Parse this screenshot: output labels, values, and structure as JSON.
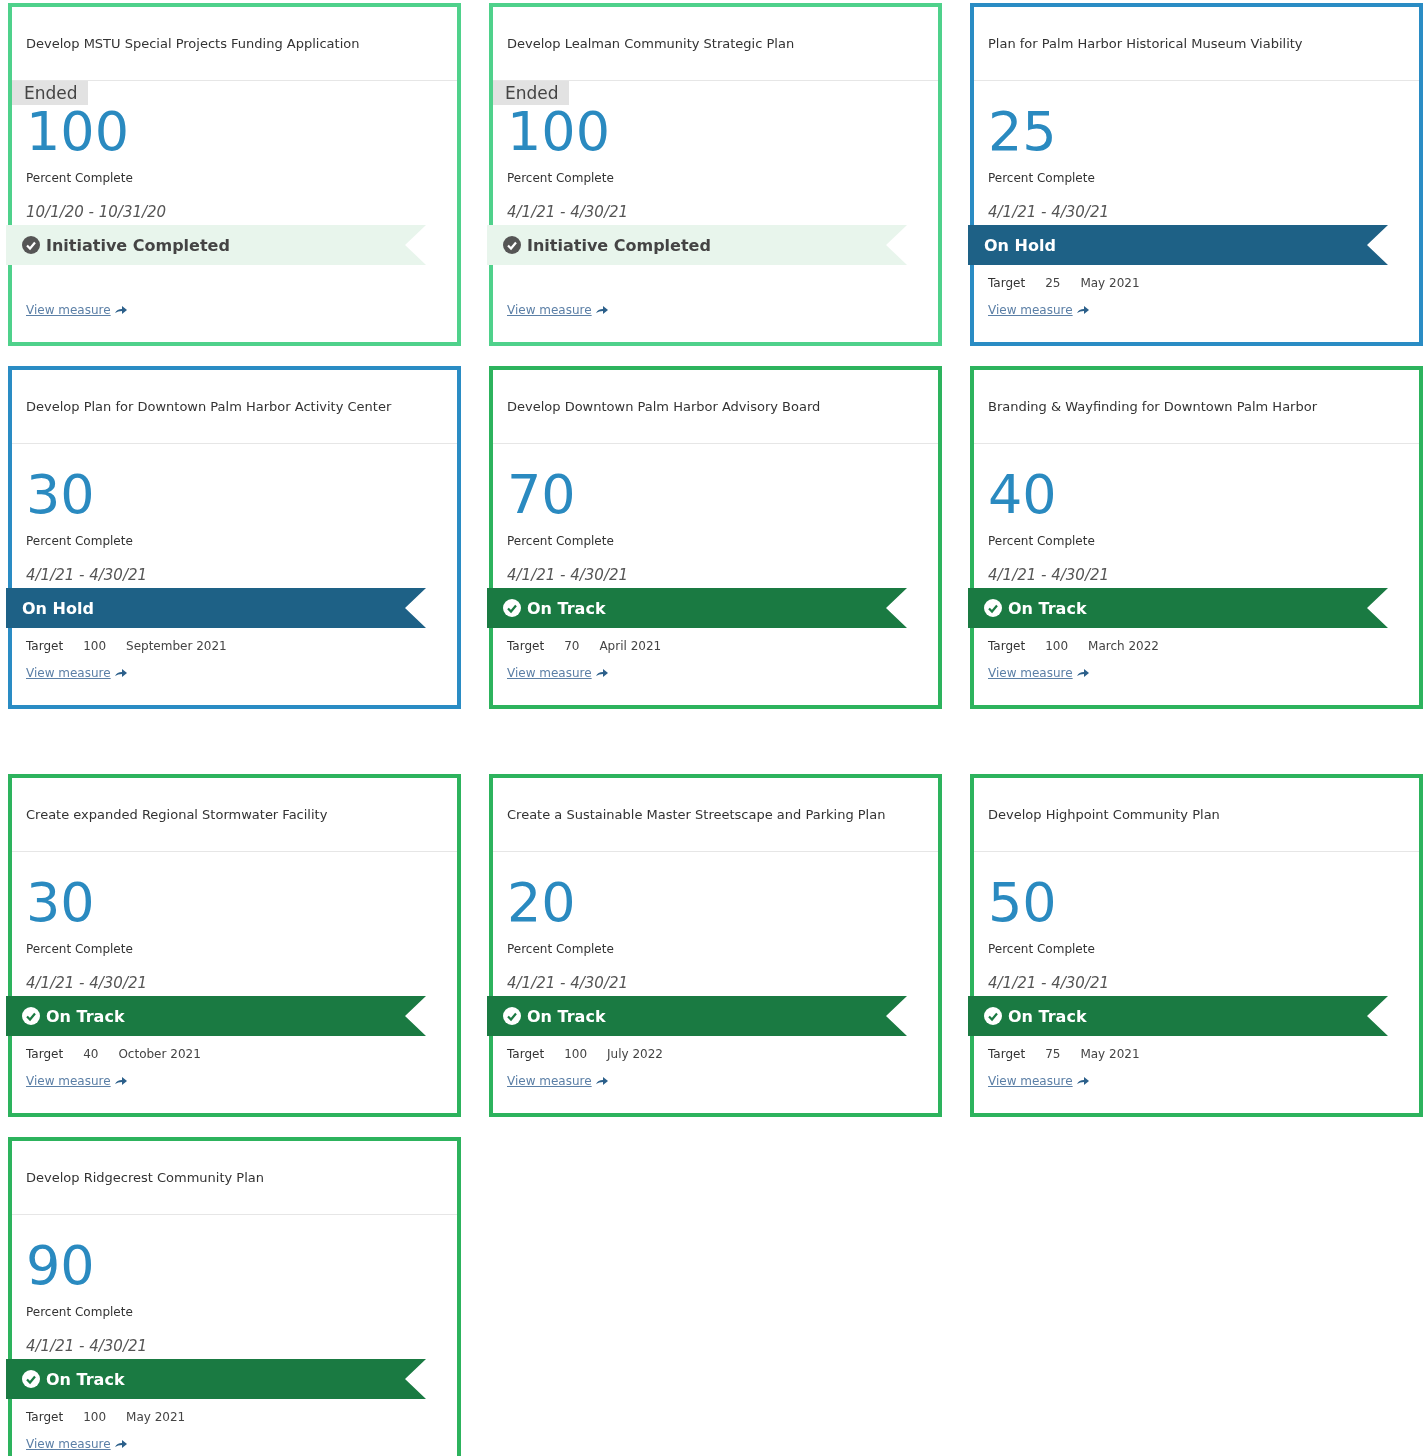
{
  "cards": [
    {
      "title": "Develop MSTU Special Projects Funding Application",
      "ended": true,
      "badge": "Ended",
      "value": "100",
      "value_label": "Percent Complete",
      "dates": "10/1/20 - 10/31/20",
      "status": {
        "kind": "completed",
        "label": "Initiative Completed"
      },
      "link": "View measure"
    },
    {
      "title": "Develop Lealman Community Strategic Plan",
      "ended": true,
      "badge": "Ended",
      "value": "100",
      "value_label": "Percent Complete",
      "dates": "4/1/21 - 4/30/21",
      "status": {
        "kind": "completed",
        "label": "Initiative Completed"
      },
      "link": "View measure"
    },
    {
      "title": "Plan for Palm Harbor Historical Museum Viability",
      "ended": false,
      "value": "25",
      "value_label": "Percent Complete",
      "dates": "4/1/21 - 4/30/21",
      "status": {
        "kind": "on_hold",
        "label": "On Hold"
      },
      "target": {
        "label": "Target",
        "value": "25",
        "date": "May 2021"
      },
      "link": "View measure"
    },
    {
      "title": "Develop Plan for Downtown Palm Harbor Activity Center",
      "ended": false,
      "value": "30",
      "value_label": "Percent Complete",
      "dates": "4/1/21 - 4/30/21",
      "status": {
        "kind": "on_hold",
        "label": "On Hold"
      },
      "target": {
        "label": "Target",
        "value": "100",
        "date": "September 2021"
      },
      "link": "View measure"
    },
    {
      "title": "Develop Downtown Palm Harbor Advisory Board",
      "ended": false,
      "value": "70",
      "value_label": "Percent Complete",
      "dates": "4/1/21 - 4/30/21",
      "status": {
        "kind": "on_track",
        "label": "On Track"
      },
      "target": {
        "label": "Target",
        "value": "70",
        "date": "April 2021"
      },
      "link": "View measure"
    },
    {
      "title": "Branding & Wayfinding for Downtown Palm Harbor",
      "ended": false,
      "value": "40",
      "value_label": "Percent Complete",
      "dates": "4/1/21 - 4/30/21",
      "status": {
        "kind": "on_track",
        "label": "On Track"
      },
      "target": {
        "label": "Target",
        "value": "100",
        "date": "March 2022"
      },
      "link": "View measure"
    },
    {
      "title": "Create expanded Regional Stormwater Facility",
      "ended": false,
      "value": "30",
      "value_label": "Percent Complete",
      "dates": "4/1/21 - 4/30/21",
      "status": {
        "kind": "on_track",
        "label": "On Track"
      },
      "target": {
        "label": "Target",
        "value": "40",
        "date": "October 2021"
      },
      "link": "View measure"
    },
    {
      "title": "Create a Sustainable Master Streetscape and Parking Plan",
      "ended": false,
      "value": "20",
      "value_label": "Percent Complete",
      "dates": "4/1/21 - 4/30/21",
      "status": {
        "kind": "on_track",
        "label": "On Track"
      },
      "target": {
        "label": "Target",
        "value": "100",
        "date": "July 2022"
      },
      "link": "View measure"
    },
    {
      "title": "Develop Highpoint Community Plan",
      "ended": false,
      "value": "50",
      "value_label": "Percent Complete",
      "dates": "4/1/21 - 4/30/21",
      "status": {
        "kind": "on_track",
        "label": "On Track"
      },
      "target": {
        "label": "Target",
        "value": "75",
        "date": "May 2021"
      },
      "link": "View measure"
    },
    {
      "title": "Develop Ridgecrest Community Plan",
      "ended": false,
      "value": "90",
      "value_label": "Percent Complete",
      "dates": "4/1/21 - 4/30/21",
      "status": {
        "kind": "on_track",
        "label": "On Track"
      },
      "target": {
        "label": "Target",
        "value": "100",
        "date": "May 2021"
      },
      "link": "View measure"
    }
  ]
}
